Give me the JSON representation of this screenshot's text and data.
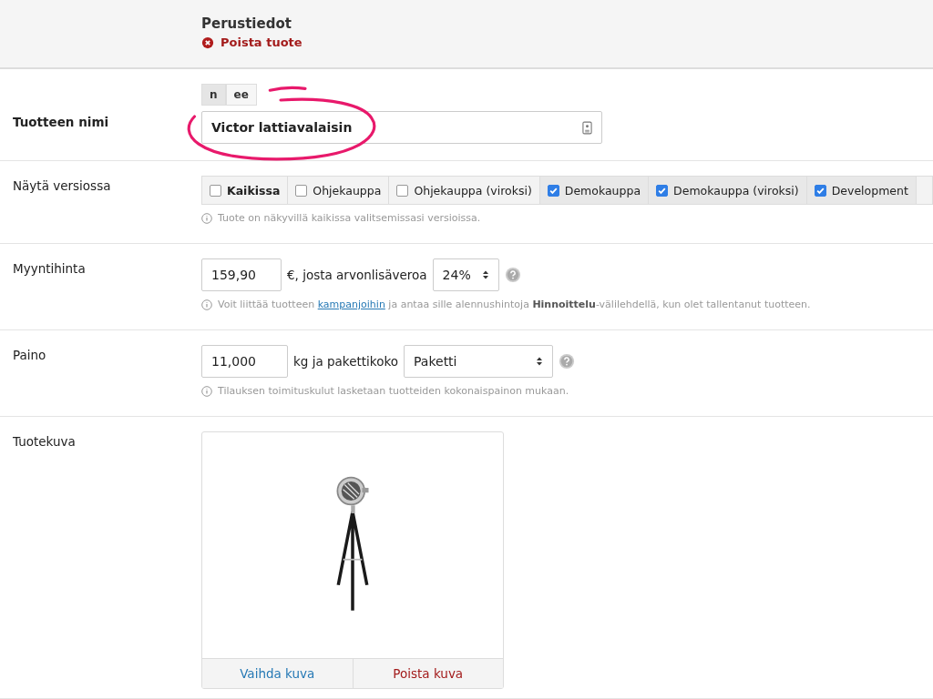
{
  "header": {
    "title": "Perustiedot",
    "delete_link": "Poista tuote"
  },
  "name_row": {
    "label": "Tuotteen nimi",
    "languages": [
      {
        "label": "n",
        "selected": true
      },
      {
        "label": "ee",
        "selected": false
      }
    ],
    "value": "Victor lattiavalaisin"
  },
  "versions_row": {
    "label": "Näytä versiossa",
    "options": [
      {
        "label": "Kaikissa",
        "checked": false,
        "kind": "all"
      },
      {
        "label": "Ohjekauppa",
        "checked": false,
        "kind": "shop"
      },
      {
        "label": "Ohjekauppa (viroksi)",
        "checked": false,
        "kind": "shop"
      },
      {
        "label": "Demokauppa",
        "checked": true,
        "kind": "shop"
      },
      {
        "label": "Demokauppa (viroksi)",
        "checked": true,
        "kind": "shop"
      },
      {
        "label": "Development",
        "checked": true,
        "kind": "shop"
      }
    ],
    "hint": "Tuote on näkyvillä kaikissa valitsemissasi versioissa."
  },
  "price_row": {
    "label": "Myyntihinta",
    "value": "159,90",
    "text": "€, josta arvonlisäveroa",
    "vat": "24%",
    "hint_before": "Voit liittää tuotteen",
    "hint_link": "kampanjoihin",
    "hint_after": "ja antaa sille alennushintoja **Hinnoittelu**-välilehdellä, kun olet tallentanut tuotteen."
  },
  "weight_row": {
    "label": "Paino",
    "value": "11,000",
    "text": "kg ja pakettikoko",
    "package": "Paketti",
    "hint": "Tilauksen toimituskulut lasketaan tuotteiden kokonaispainon mukaan."
  },
  "image_row": {
    "label": "Tuotekuva",
    "change_button": "Vaihda kuva",
    "delete_button": "Poista kuva"
  }
}
